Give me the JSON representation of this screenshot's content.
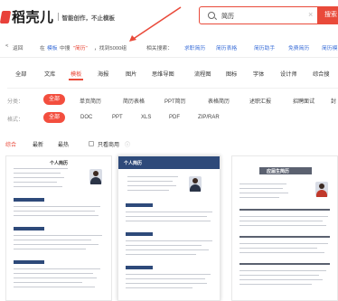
{
  "header": {
    "logo_text": "稻壳儿",
    "slogan": "智能创作，不止模板",
    "search_value": "简历",
    "search_clear": "×",
    "search_button": "搜索"
  },
  "breadcrumb": {
    "back": "返回",
    "in": "在",
    "category": "模板",
    "middle": "中搜",
    "query": "\"简历\"",
    "result": "，找到5000组",
    "related_label": "相关搜索：",
    "related": [
      "求职简历",
      "简历表格",
      "简历助手",
      "免费简历",
      "简历模"
    ]
  },
  "tabs": [
    "全部",
    "文库",
    "模板",
    "海报",
    "图片",
    "思维导图",
    "流程图",
    "图标",
    "字体",
    "设计师",
    "综合搜"
  ],
  "active_tab": "模板",
  "filters": {
    "category_label": "分类：",
    "categories": [
      "全部",
      "单页简历",
      "简历表格",
      "PPT简历",
      "表格简历",
      "述职汇报",
      "招聘面试",
      "封"
    ],
    "format_label": "格式：",
    "formats": [
      "全部",
      "DOC",
      "PPT",
      "XLS",
      "PDF",
      "ZIP/RAR"
    ]
  },
  "sort": {
    "options": [
      "综合",
      "最新",
      "最热"
    ],
    "only_free": "只看商用",
    "info_icon": "ⓘ"
  },
  "cards": [
    {
      "title": "个人简历"
    },
    {
      "title": "个人简历"
    },
    {
      "title": "应届生简历"
    }
  ],
  "colors": {
    "accent": "#e94a3a",
    "link": "#3c6fd8"
  }
}
